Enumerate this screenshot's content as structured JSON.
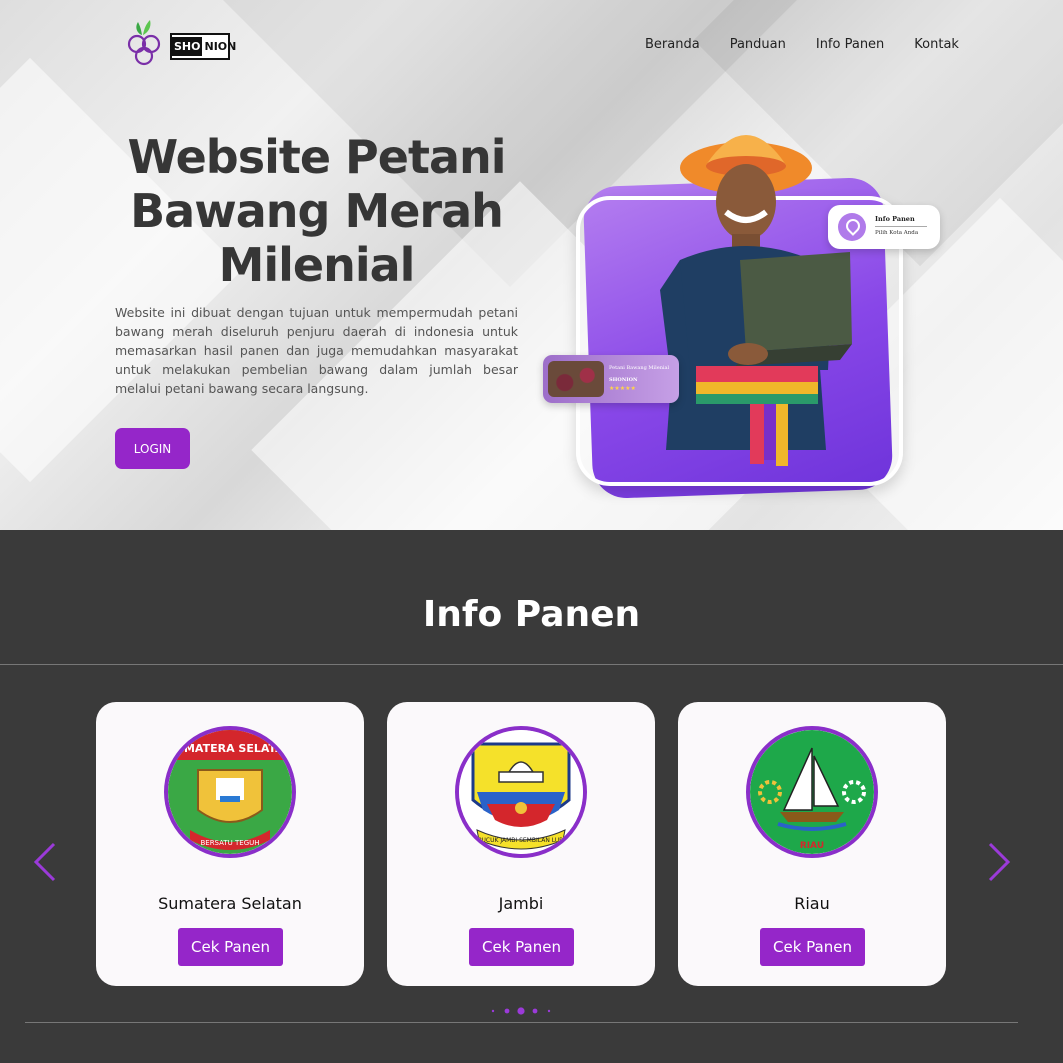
{
  "brand": {
    "logo_left": "SHO",
    "logo_right": "NION"
  },
  "nav": {
    "items": [
      "Beranda",
      "Panduan",
      "Info Panen",
      "Kontak"
    ]
  },
  "hero": {
    "title": "Website Petani Bawang Merah Milenial",
    "description": "Website ini dibuat dengan tujuan untuk mempermudah petani bawang merah diseluruh penjuru daerah di indonesia untuk memasarkan hasil panen dan juga memudahkan masyarakat untuk melakukan pembelian bawang dalam jumlah besar melalui petani bawang secara langsung.",
    "login_label": "LOGIN",
    "info_card": {
      "title": "Info Panen",
      "subtitle": "Pilih Kota Anda"
    },
    "product_card": {
      "title": "Petani Bawang Milenial",
      "brand": "SHONION",
      "stars": "★★★★★"
    }
  },
  "info_panen": {
    "title": "Info Panen",
    "cards": [
      {
        "name": "Sumatera Selatan",
        "button": "Cek Panen",
        "emblem_text": "SUMATERA SELATAN",
        "emblem_motto": "BERSATU TEGUH"
      },
      {
        "name": "Jambi",
        "button": "Cek Panen",
        "emblem_motto": "SEPUCUK JAMBI SEMBILAN LURAH"
      },
      {
        "name": "Riau",
        "button": "Cek Panen",
        "emblem_motto": "RIAU"
      }
    ],
    "carousel": {
      "active_index": 1,
      "dot_count": 5
    }
  },
  "colors": {
    "accent": "#9526c9",
    "dark_bg": "#3a3a3a",
    "card_bg": "#fbf9fb"
  }
}
